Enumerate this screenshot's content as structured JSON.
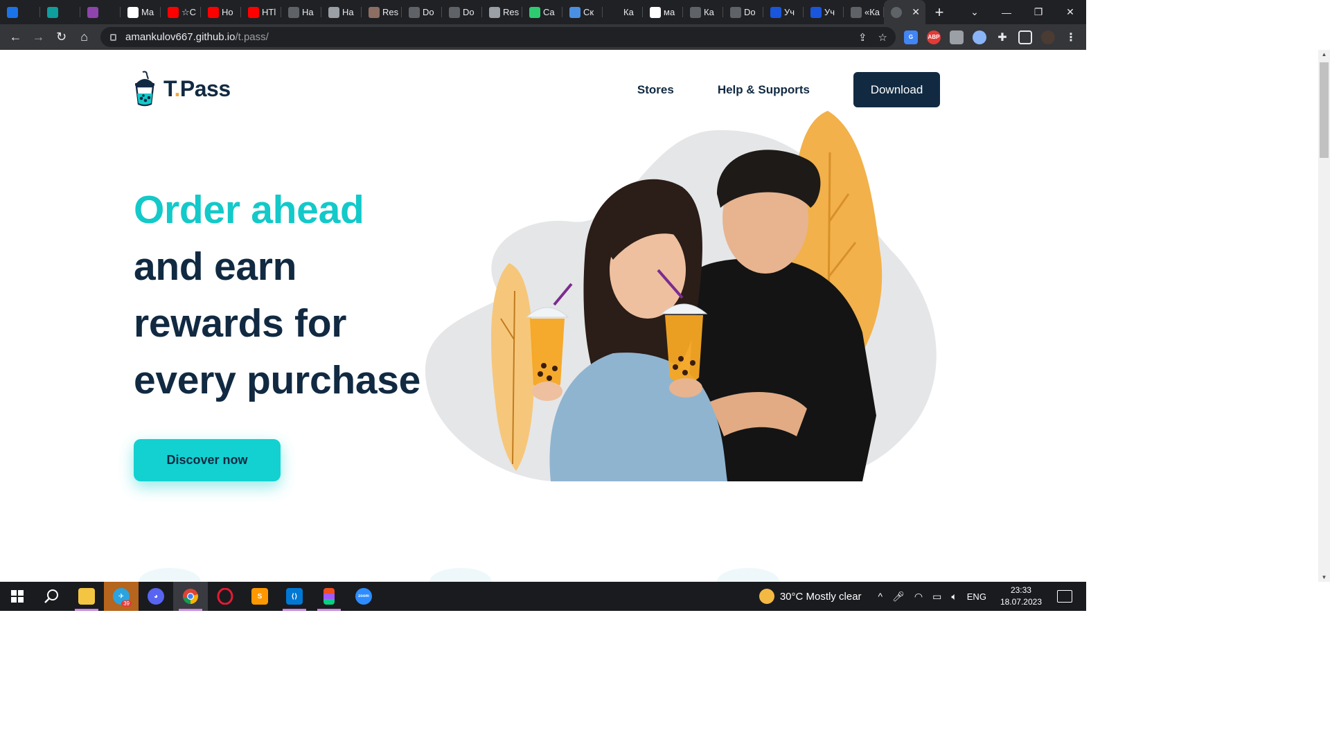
{
  "browser": {
    "tabs": [
      {
        "title": "",
        "favicon": "script-s-icon",
        "color": "#1a73e8"
      },
      {
        "title": "",
        "favicon": "copyright-icon",
        "color": "#0f9d9d"
      },
      {
        "title": "",
        "favicon": "u-shield-icon",
        "color": "#8e44ad"
      },
      {
        "title": "Ma",
        "favicon": "m-logo-icon",
        "color": "#ffffff"
      },
      {
        "title": "☆C",
        "favicon": "youtube-icon",
        "color": "#ff0000"
      },
      {
        "title": "Ho",
        "favicon": "youtube-icon",
        "color": "#ff0000"
      },
      {
        "title": "HTl",
        "favicon": "youtube-icon",
        "color": "#ff0000"
      },
      {
        "title": "Ha",
        "favicon": "portrait-icon",
        "color": "#5f6368"
      },
      {
        "title": "Ha",
        "favicon": "document-icon",
        "color": "#9aa0a6"
      },
      {
        "title": "Res",
        "favicon": "book-icon",
        "color": "#8d6e63"
      },
      {
        "title": "Do",
        "favicon": "globe-icon",
        "color": "#5f6368"
      },
      {
        "title": "Do",
        "favicon": "globe-icon",
        "color": "#5f6368"
      },
      {
        "title": "Res",
        "favicon": "reader-icon",
        "color": "#9aa0a6"
      },
      {
        "title": "Ca",
        "favicon": "v-logo-icon",
        "color": "#2ecc71"
      },
      {
        "title": "Ск",
        "favicon": "diamond-icon",
        "color": "#4a90e2"
      },
      {
        "title": "Ка",
        "favicon": "blank-icon",
        "color": "#202124"
      },
      {
        "title": "ма",
        "favicon": "google-icon",
        "color": "#ffffff"
      },
      {
        "title": "Ка",
        "favicon": "app-icon",
        "color": "#5f6368"
      },
      {
        "title": "Do",
        "favicon": "globe-icon",
        "color": "#5f6368"
      },
      {
        "title": "Уч",
        "favicon": "z-logo-icon",
        "color": "#1a56db"
      },
      {
        "title": "Уч",
        "favicon": "z-logo-icon",
        "color": "#1a56db"
      },
      {
        "title": "«Ка",
        "favicon": "mask-icon",
        "color": "#5f6368"
      }
    ],
    "active_tab_favicon": "globe-icon",
    "url_host": "amankulov667.github.io",
    "url_path": "/t.pass/"
  },
  "site": {
    "logo_brand": "T",
    "logo_dot": ".",
    "logo_rest": "Pass",
    "nav": {
      "stores": "Stores",
      "help": "Help & Supports",
      "download": "Download"
    },
    "hero": {
      "line1": "Order ahead",
      "line2": "and earn",
      "line3": "rewards for",
      "line4": "every purchase"
    },
    "cta": "Discover now",
    "colors": {
      "primary_dark": "#112a42",
      "accent_teal": "#13c9c9",
      "accent_orange": "#f2a93b"
    }
  },
  "taskbar": {
    "telegram_badge": "39",
    "weather": "30°C  Mostly clear",
    "language": "ENG",
    "time": "23:33",
    "date": "18.07.2023"
  }
}
